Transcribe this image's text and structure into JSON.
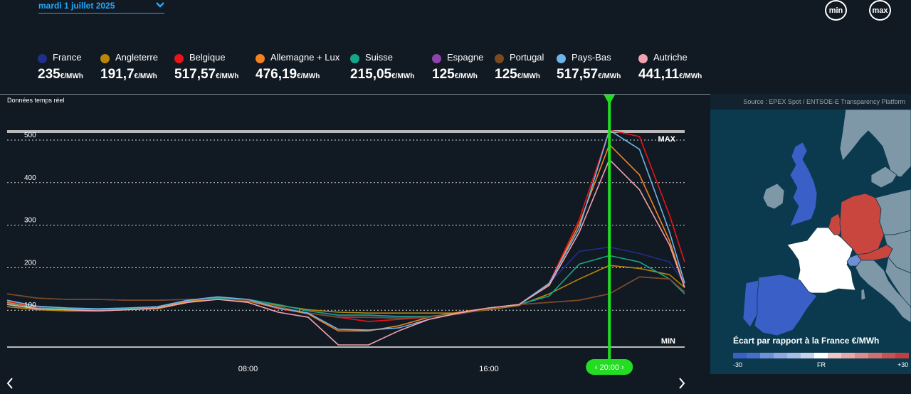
{
  "header": {
    "date_label": "mardi 1 juillet 2025",
    "min_label": "min",
    "max_label": "max"
  },
  "legend": [
    {
      "name": "France",
      "color": "#1f2f8a",
      "value": "235",
      "unit": "€/MWh"
    },
    {
      "name": "Angleterre",
      "color": "#b8860b",
      "value": "191,7",
      "unit": "€/MWh"
    },
    {
      "name": "Belgique",
      "color": "#e8141b",
      "value": "517,57",
      "unit": "€/MWh"
    },
    {
      "name": "Allemagne + Lux",
      "color": "#f5821f",
      "value": "476,19",
      "unit": "€/MWh"
    },
    {
      "name": "Suisse",
      "color": "#17a589",
      "value": "215,05",
      "unit": "€/MWh"
    },
    {
      "name": "Espagne",
      "color": "#8e44ad",
      "value": "125",
      "unit": "€/MWh"
    },
    {
      "name": "Portugal",
      "color": "#7a4a1e",
      "value": "125",
      "unit": "€/MWh"
    },
    {
      "name": "Pays-Bas",
      "color": "#6fb3e8",
      "value": "517,57",
      "unit": "€/MWh"
    },
    {
      "name": "Autriche",
      "color": "#f2a1b0",
      "value": "441,11",
      "unit": "€/MWh"
    }
  ],
  "chart_data": {
    "type": "line",
    "subtitle": "Données temps réel",
    "y_ticks": [
      "500",
      "400",
      "300",
      "200",
      "100"
    ],
    "ylim": [
      0,
      510
    ],
    "x_ticks": [
      "08:00",
      "16:00"
    ],
    "x_tick_hours": [
      8,
      16
    ],
    "xlim": [
      0,
      22.5
    ],
    "max_label": "MAX",
    "min_label": "MIN",
    "selected_time": "20:00",
    "selected_hour": 20,
    "grid": true,
    "x": [
      0,
      1,
      2,
      3,
      4,
      5,
      6,
      7,
      8,
      9,
      10,
      11,
      12,
      13,
      14,
      15,
      16,
      17,
      18,
      19,
      20,
      21,
      22,
      22.5
    ],
    "series": [
      {
        "name": "France",
        "color": "#1f2f8a",
        "values": [
          110,
          95,
          92,
          90,
          92,
          95,
          110,
          118,
          110,
          95,
          80,
          72,
          70,
          70,
          72,
          78,
          90,
          100,
          150,
          225,
          235,
          220,
          200,
          150
        ]
      },
      {
        "name": "Angleterre",
        "color": "#b8860b",
        "values": [
          95,
          88,
          85,
          85,
          88,
          90,
          105,
          115,
          108,
          98,
          88,
          82,
          80,
          80,
          80,
          80,
          88,
          98,
          125,
          160,
          192,
          185,
          170,
          140
        ]
      },
      {
        "name": "Belgique",
        "color": "#e8141b",
        "values": [
          108,
          95,
          90,
          88,
          90,
          95,
          110,
          118,
          110,
          90,
          80,
          70,
          60,
          65,
          70,
          80,
          90,
          100,
          150,
          300,
          510,
          495,
          310,
          200
        ]
      },
      {
        "name": "Allemagne + Lux",
        "color": "#f5821f",
        "values": [
          105,
          92,
          88,
          85,
          88,
          92,
          108,
          115,
          108,
          92,
          78,
          38,
          38,
          50,
          70,
          82,
          92,
          100,
          148,
          290,
          476,
          405,
          250,
          140
        ]
      },
      {
        "name": "Suisse",
        "color": "#17a589",
        "values": [
          102,
          92,
          90,
          88,
          90,
          95,
          110,
          115,
          112,
          100,
          85,
          75,
          75,
          72,
          72,
          78,
          90,
          100,
          120,
          195,
          215,
          200,
          160,
          125
        ]
      },
      {
        "name": "Espagne",
        "color": "#8e44ad",
        "values": [
          125,
          115,
          112,
          112,
          110,
          110,
          112,
          112,
          110,
          95,
          80,
          70,
          70,
          68,
          70,
          78,
          90,
          100,
          105,
          110,
          125,
          165,
          160,
          130
        ]
      },
      {
        "name": "Portugal",
        "color": "#7a4a1e",
        "values": [
          125,
          115,
          112,
          112,
          110,
          110,
          112,
          112,
          110,
          95,
          80,
          70,
          70,
          68,
          70,
          78,
          90,
          100,
          105,
          110,
          125,
          165,
          160,
          130
        ]
      },
      {
        "name": "Pays-Bas",
        "color": "#6fb3e8",
        "values": [
          110,
          96,
          92,
          90,
          92,
          95,
          110,
          118,
          112,
          92,
          80,
          42,
          40,
          45,
          65,
          80,
          92,
          100,
          150,
          280,
          510,
          465,
          270,
          150
        ]
      },
      {
        "name": "Autriche",
        "color": "#f2a1b0",
        "values": [
          100,
          90,
          88,
          85,
          88,
          92,
          105,
          112,
          105,
          82,
          70,
          5,
          5,
          38,
          65,
          80,
          92,
          100,
          145,
          270,
          441,
          370,
          240,
          140
        ]
      }
    ]
  },
  "map": {
    "source": "Source : EPEX Spot / ENTSOE-E Transparency Platform",
    "legend_title": "Écart par rapport à la France €/MWh",
    "scale_min": "-30",
    "scale_mid": "FR",
    "scale_max": "+30",
    "scale_colors": [
      "#3a5fc7",
      "#4a6dcc",
      "#6f8fd6",
      "#8fa8de",
      "#aabbe3",
      "#c6d2ee",
      "#ffffff",
      "#efc6c6",
      "#e6a8a8",
      "#dc8c8c",
      "#d26f6f",
      "#c85353",
      "#c0403f"
    ],
    "colors": {
      "sea": "#0b3a4f",
      "neutral": "#7f98a8",
      "france": "#ffffff",
      "cheaper": "#3a5fc7",
      "pricier": "#c9463f",
      "slightly_cheaper": "#6f8fd6"
    }
  }
}
